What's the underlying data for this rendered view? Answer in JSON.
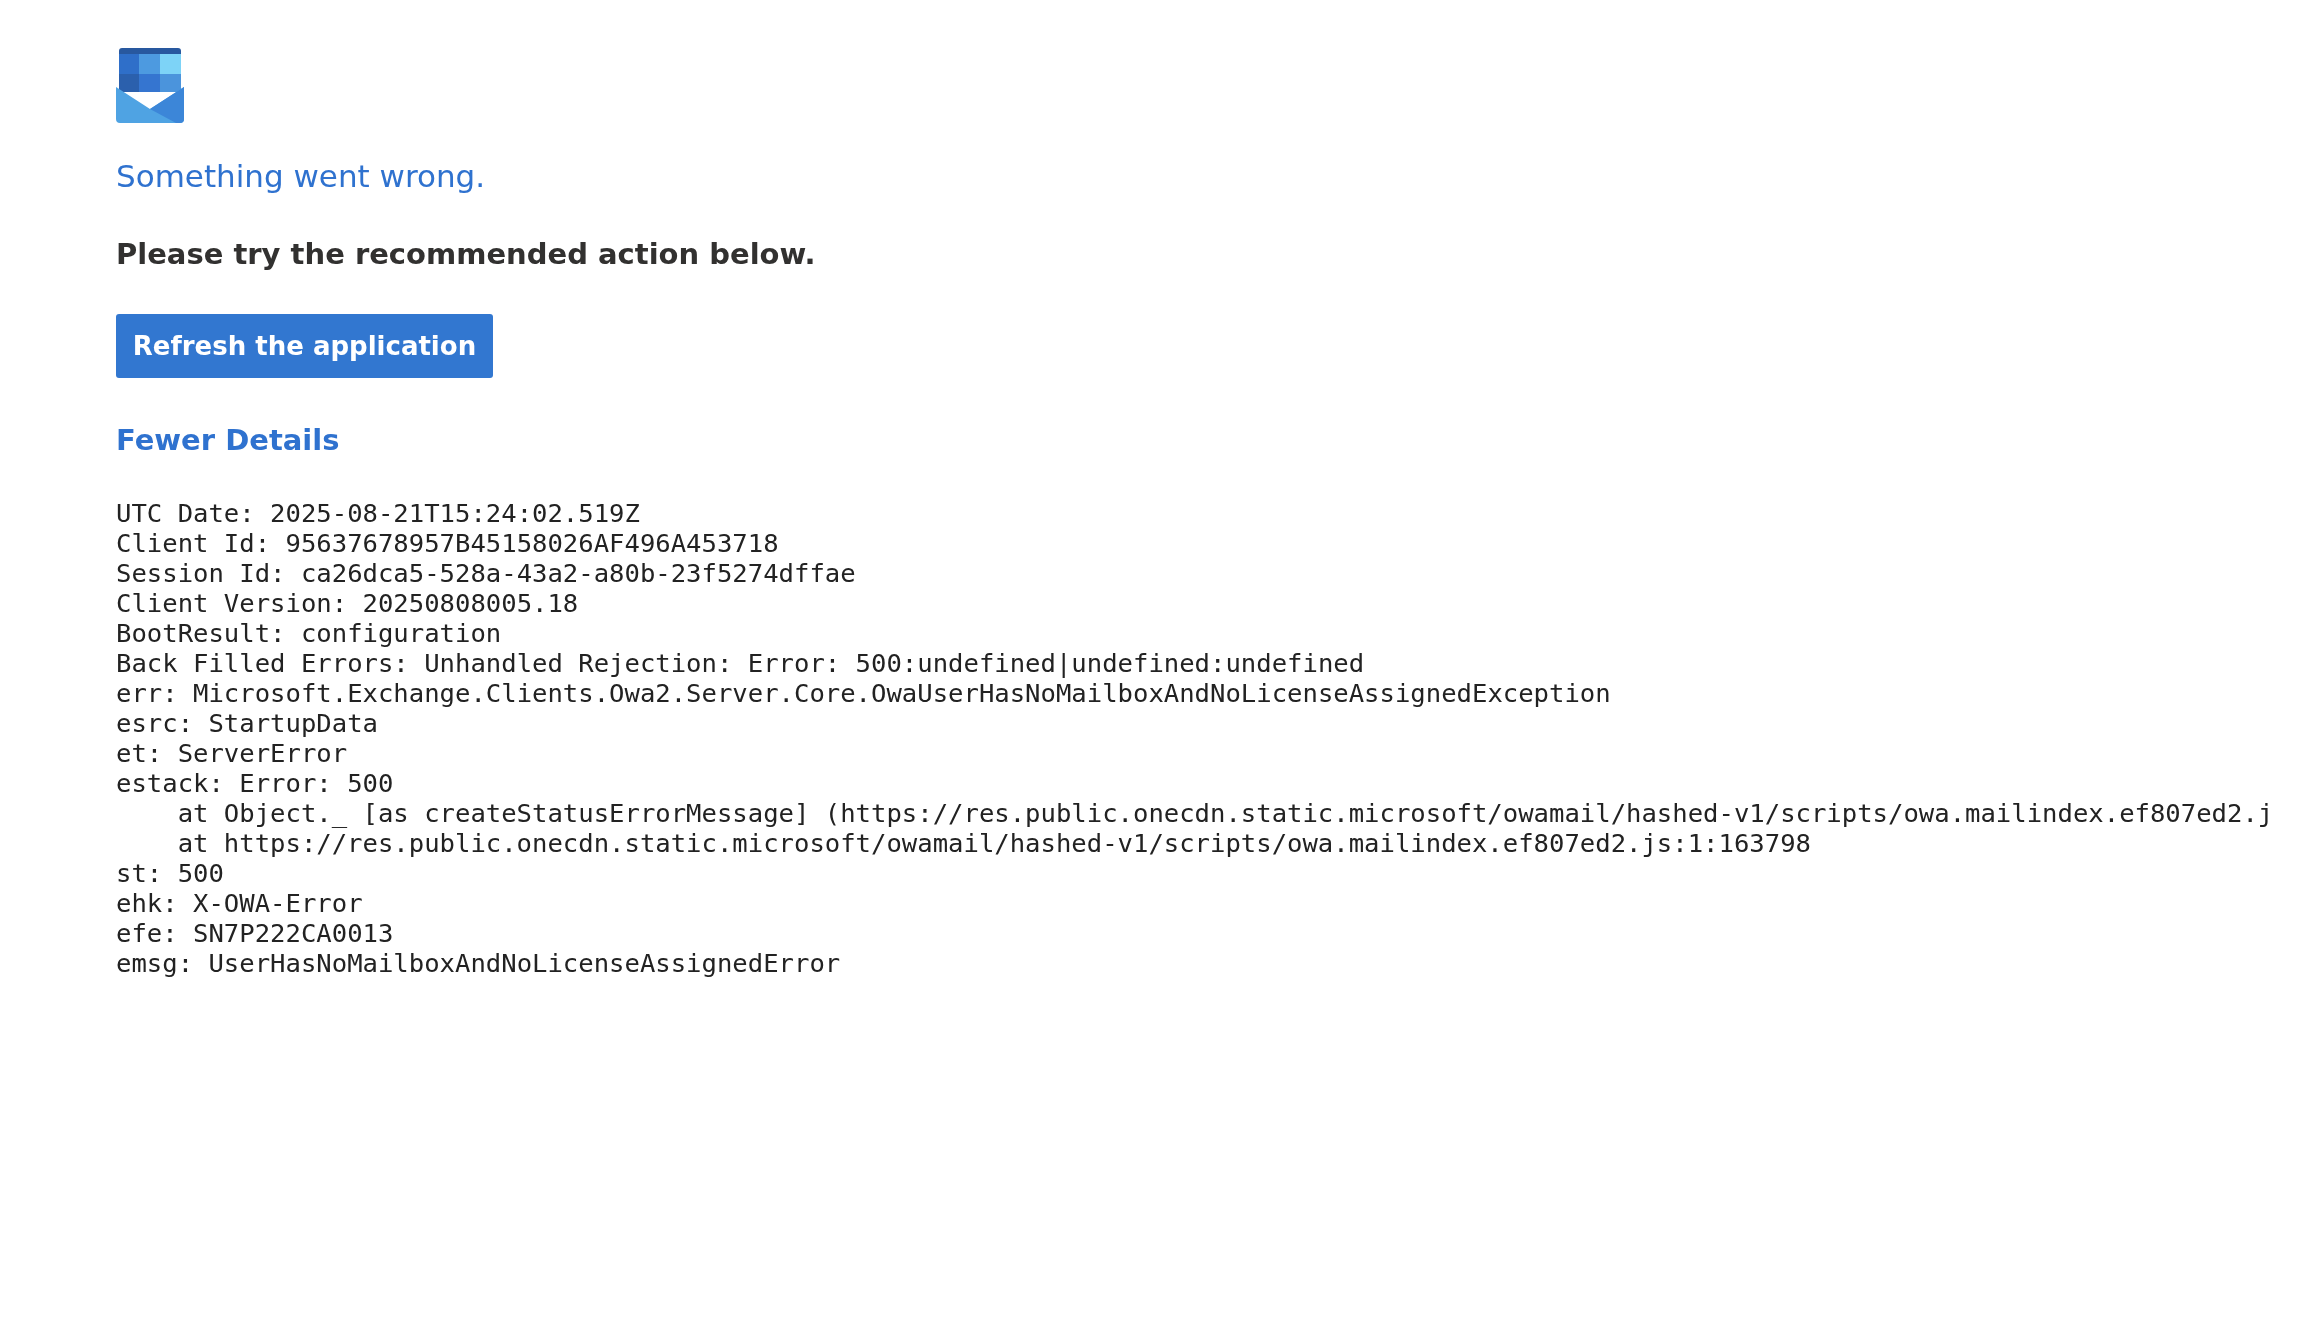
{
  "error": {
    "title": "Something went wrong.",
    "prompt": "Please try the recommended action below."
  },
  "action_button": {
    "label": "Refresh the application"
  },
  "details_toggle": {
    "label": "Fewer Details"
  },
  "details": [
    {
      "kind": "field",
      "text": "UTC Date: 2025-08-21T15:24:02.519Z"
    },
    {
      "kind": "field",
      "text": "Client Id: 95637678957B45158026AF496A453718"
    },
    {
      "kind": "field",
      "text": "Session Id: ca26dca5-528a-43a2-a80b-23f5274dffae"
    },
    {
      "kind": "field",
      "text": "Client Version: 20250808005.18"
    },
    {
      "kind": "field",
      "text": "BootResult: configuration"
    },
    {
      "kind": "field",
      "text": "Back Filled Errors: Unhandled Rejection: Error: 500:undefined|undefined:undefined"
    },
    {
      "kind": "field",
      "text": "err: Microsoft.Exchange.Clients.Owa2.Server.Core.OwaUserHasNoMailboxAndNoLicenseAssignedException"
    },
    {
      "kind": "field",
      "text": "esrc: StartupData"
    },
    {
      "kind": "field",
      "text": "et: ServerError"
    },
    {
      "kind": "field",
      "text": "estack: Error: 500"
    },
    {
      "kind": "stack",
      "text": "at Object._ [as createStatusErrorMessage] (https://res.public.onecdn.static.microsoft/owamail/hashed-v1/scripts/owa.mailindex.ef807ed2.j"
    },
    {
      "kind": "stack",
      "text": "at https://res.public.onecdn.static.microsoft/owamail/hashed-v1/scripts/owa.mailindex.ef807ed2.js:1:163798"
    },
    {
      "kind": "field",
      "text": "st: 500"
    },
    {
      "kind": "field",
      "text": "ehk: X-OWA-Error"
    },
    {
      "kind": "field",
      "text": "efe: SN7P222CA0013"
    },
    {
      "kind": "field",
      "text": "emsg: UserHasNoMailboxAndNoLicenseAssignedError"
    }
  ]
}
